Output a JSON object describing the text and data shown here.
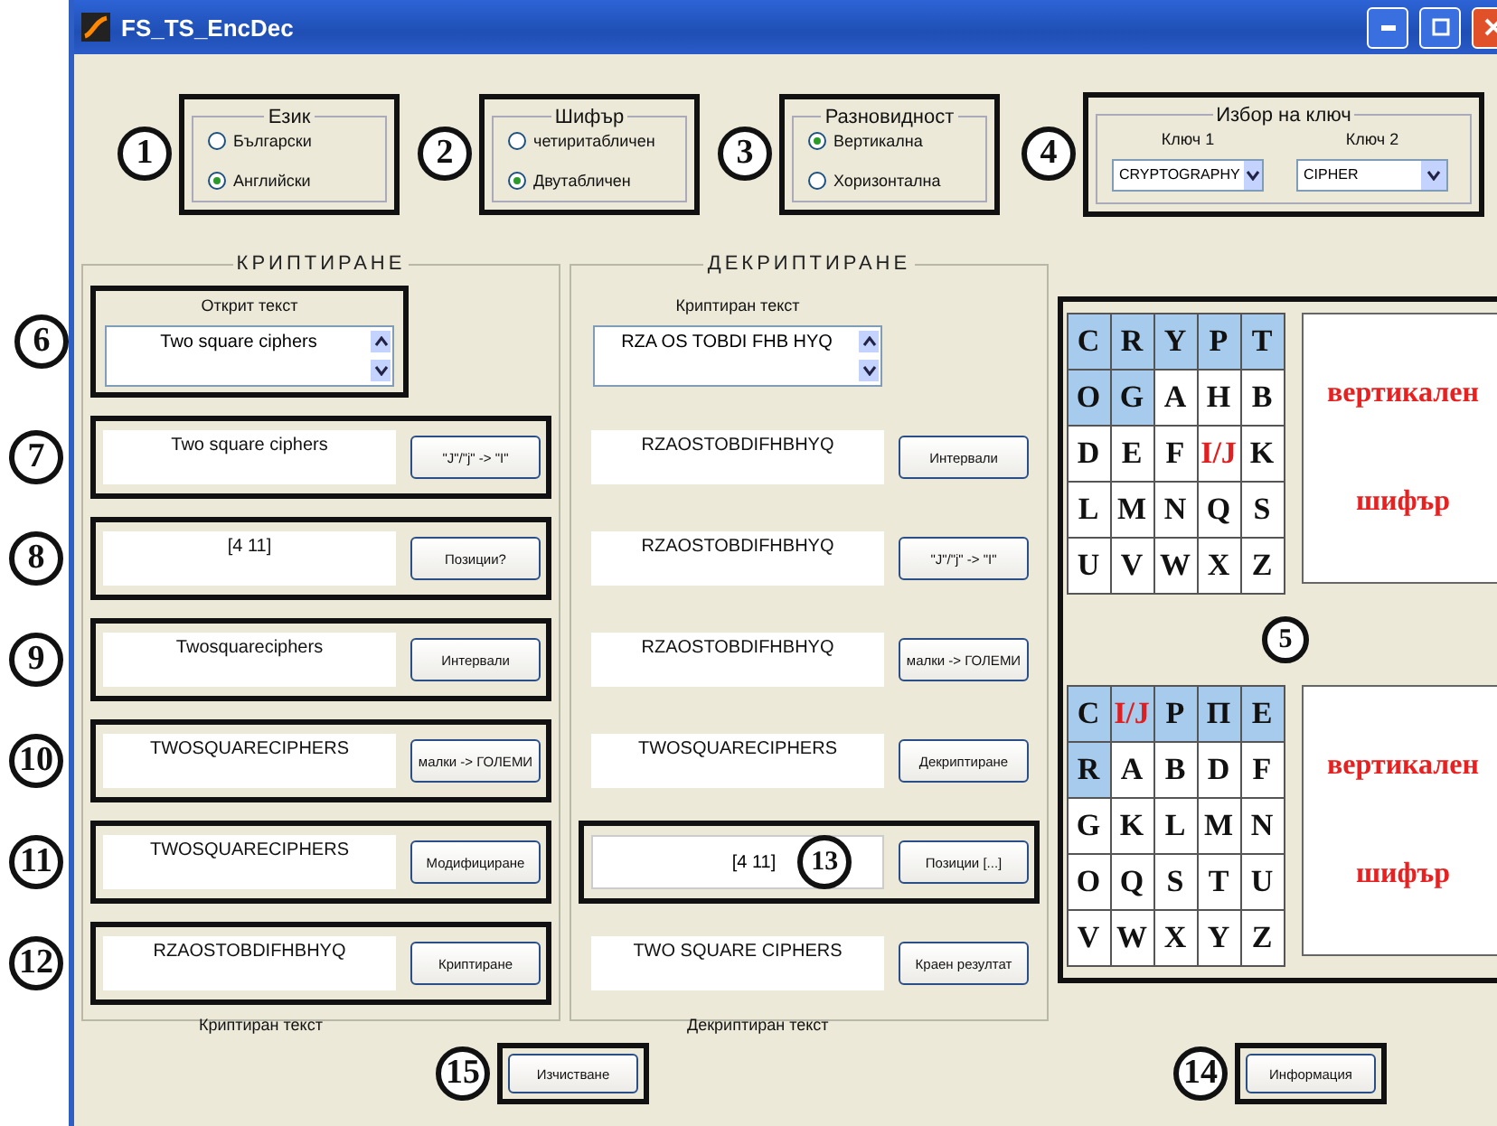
{
  "window": {
    "title": "FS_TS_EncDec"
  },
  "top_groups": [
    {
      "kind": "radio",
      "marker": "1",
      "title": "Език",
      "options": [
        {
          "label": "Български",
          "selected": false
        },
        {
          "label": "Английски",
          "selected": true
        }
      ]
    },
    {
      "kind": "radio",
      "marker": "2",
      "title": "Шифър",
      "options": [
        {
          "label": "четиритабличен",
          "selected": false
        },
        {
          "label": "Двутабличен",
          "selected": true
        }
      ]
    },
    {
      "kind": "radio",
      "marker": "3",
      "title": "Разновидност",
      "options": [
        {
          "label": "Вертикална",
          "selected": true
        },
        {
          "label": "Хоризонтална",
          "selected": false
        }
      ]
    },
    {
      "kind": "keys",
      "marker": "4",
      "title": "Избор на ключ",
      "keys": [
        {
          "label": "Ключ 1",
          "value": "CRYPTOGRAPHY"
        },
        {
          "label": "Ключ 2",
          "value": "CIPHER"
        }
      ]
    }
  ],
  "encryption": {
    "title": "КРИПТИРАНЕ",
    "input": {
      "marker": "6",
      "label": "Открит текст",
      "value": "Two square ciphers"
    },
    "steps": [
      {
        "marker": "7",
        "value": "Two square ciphers",
        "button": "\"J\"/\"j\" -> \"I\""
      },
      {
        "marker": "8",
        "value": "[4 11]",
        "button": "Позиции?"
      },
      {
        "marker": "9",
        "value": "Twosquareciphers",
        "button": "Интервали"
      },
      {
        "marker": "10",
        "value": "TWOSQUARECIPHERS",
        "button": "малки -> ГОЛЕМИ"
      },
      {
        "marker": "11",
        "value": "TWOSQUARECIPHERS",
        "button": "Модифициране"
      },
      {
        "marker": "12",
        "value": "RZAOSTOBDIFHBHYQ",
        "button": "Криптиране"
      }
    ],
    "footer": "Криптиран текст"
  },
  "decryption": {
    "title": "ДЕКРИПТИРАНЕ",
    "input": {
      "label": "Криптиран текст",
      "value": "RZA OS TOBDI FHB HYQ"
    },
    "steps": [
      {
        "value": "RZAOSTOBDIFHBHYQ",
        "button": "Интервали"
      },
      {
        "value": "RZAOSTOBDIFHBHYQ",
        "button": "\"J\"/\"j\" -> \"I\""
      },
      {
        "value": "RZAOSTOBDIFHBHYQ",
        "button": "малки -> ГОЛЕМИ"
      },
      {
        "value": "TWOSQUARECIPHERS",
        "button": "Декриптиране"
      },
      {
        "marker": "13",
        "value": "[4 11]",
        "button": "Позиции [...]"
      },
      {
        "value": "TWO SQUARE CIPHERS",
        "button": "Краен резултат"
      }
    ],
    "footer": "Декриптиран текст"
  },
  "squares": {
    "marker": "5",
    "tables": [
      {
        "caption": [
          "вертикален",
          "шифър"
        ],
        "rows": [
          [
            {
              "letter": "C",
              "key": true,
              "accent": false
            },
            {
              "letter": "R",
              "key": true,
              "accent": false
            },
            {
              "letter": "Y",
              "key": true,
              "accent": false
            },
            {
              "letter": "P",
              "key": true,
              "accent": false
            },
            {
              "letter": "T",
              "key": true,
              "accent": false
            }
          ],
          [
            {
              "letter": "O",
              "key": true,
              "accent": false
            },
            {
              "letter": "G",
              "key": true,
              "accent": false
            },
            {
              "letter": "A",
              "key": false,
              "accent": false
            },
            {
              "letter": "H",
              "key": false,
              "accent": false
            },
            {
              "letter": "B",
              "key": false,
              "accent": false
            }
          ],
          [
            {
              "letter": "D",
              "key": false,
              "accent": false
            },
            {
              "letter": "E",
              "key": false,
              "accent": false
            },
            {
              "letter": "F",
              "key": false,
              "accent": false
            },
            {
              "letter": "I/J",
              "key": false,
              "accent": true
            },
            {
              "letter": "K",
              "key": false,
              "accent": false
            }
          ],
          [
            {
              "letter": "L",
              "key": false,
              "accent": false
            },
            {
              "letter": "M",
              "key": false,
              "accent": false
            },
            {
              "letter": "N",
              "key": false,
              "accent": false
            },
            {
              "letter": "Q",
              "key": false,
              "accent": false
            },
            {
              "letter": "S",
              "key": false,
              "accent": false
            }
          ],
          [
            {
              "letter": "U",
              "key": false,
              "accent": false
            },
            {
              "letter": "V",
              "key": false,
              "accent": false
            },
            {
              "letter": "W",
              "key": false,
              "accent": false
            },
            {
              "letter": "X",
              "key": false,
              "accent": false
            },
            {
              "letter": "Z",
              "key": false,
              "accent": false
            }
          ]
        ]
      },
      {
        "caption": [
          "вертикален",
          "шифър"
        ],
        "rows": [
          [
            {
              "letter": "C",
              "key": true,
              "accent": false
            },
            {
              "letter": "I/J",
              "key": true,
              "accent": true
            },
            {
              "letter": "P",
              "key": true,
              "accent": false
            },
            {
              "letter": "П",
              "key": true,
              "accent": false
            },
            {
              "letter": "E",
              "key": true,
              "accent": false
            }
          ],
          [
            {
              "letter": "R",
              "key": true,
              "accent": false
            },
            {
              "letter": "A",
              "key": false,
              "accent": false
            },
            {
              "letter": "B",
              "key": false,
              "accent": false
            },
            {
              "letter": "D",
              "key": false,
              "accent": false
            },
            {
              "letter": "F",
              "key": false,
              "accent": false
            }
          ],
          [
            {
              "letter": "G",
              "key": false,
              "accent": false
            },
            {
              "letter": "K",
              "key": false,
              "accent": false
            },
            {
              "letter": "L",
              "key": false,
              "accent": false
            },
            {
              "letter": "M",
              "key": false,
              "accent": false
            },
            {
              "letter": "N",
              "key": false,
              "accent": false
            }
          ],
          [
            {
              "letter": "O",
              "key": false,
              "accent": false
            },
            {
              "letter": "Q",
              "key": false,
              "accent": false
            },
            {
              "letter": "S",
              "key": false,
              "accent": false
            },
            {
              "letter": "T",
              "key": false,
              "accent": false
            },
            {
              "letter": "U",
              "key": false,
              "accent": false
            }
          ],
          [
            {
              "letter": "V",
              "key": false,
              "accent": false
            },
            {
              "letter": "W",
              "key": false,
              "accent": false
            },
            {
              "letter": "X",
              "key": false,
              "accent": false
            },
            {
              "letter": "Y",
              "key": false,
              "accent": false
            },
            {
              "letter": "Z",
              "key": false,
              "accent": false
            }
          ]
        ]
      }
    ]
  },
  "bottom_buttons": [
    {
      "marker": "15",
      "label": "Изчистване"
    },
    {
      "marker": "14",
      "label": "Информация"
    }
  ]
}
